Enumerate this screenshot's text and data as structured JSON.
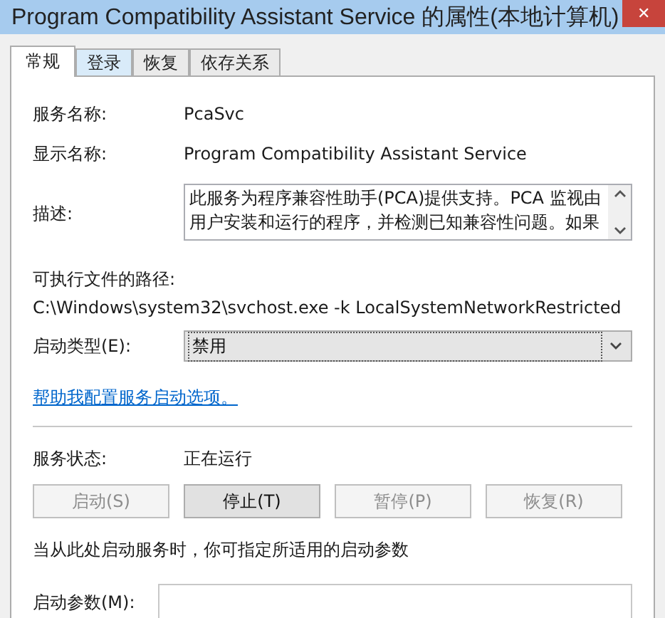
{
  "window": {
    "title": "Program Compatibility Assistant Service 的属性(本地计算机)",
    "close": "✕"
  },
  "tabs": [
    {
      "label": "常规",
      "selected": true,
      "hover": false
    },
    {
      "label": "登录",
      "selected": false,
      "hover": true
    },
    {
      "label": "恢复",
      "selected": false,
      "hover": false
    },
    {
      "label": "依存关系",
      "selected": false,
      "hover": false
    }
  ],
  "general": {
    "service_name": {
      "label": "服务名称:",
      "value": "PcaSvc"
    },
    "display_name": {
      "label": "显示名称:",
      "value": "Program Compatibility Assistant Service"
    },
    "description": {
      "label": "描述:",
      "lines": [
        "此服务为程序兼容性助手(PCA)提供支持。PCA 监视由",
        "用户安装和运行的程序，并检测已知兼容性问题。如果"
      ]
    },
    "path": {
      "label": "可执行文件的路径:",
      "value": "C:\\Windows\\system32\\svchost.exe -k LocalSystemNetworkRestricted"
    },
    "startup_type": {
      "label": "启动类型(E):",
      "value": "禁用"
    },
    "help_link": "帮助我配置服务启动选项。",
    "status": {
      "label": "服务状态:",
      "value": "正在运行"
    },
    "buttons": [
      {
        "label": "启动(S)",
        "disabled": true
      },
      {
        "label": "停止(T)",
        "disabled": false
      },
      {
        "label": "暂停(P)",
        "disabled": true
      },
      {
        "label": "恢复(R)",
        "disabled": true
      }
    ],
    "hint": "当从此处启动服务时，你可指定所适用的启动参数",
    "start_params": {
      "label": "启动参数(M):"
    }
  }
}
